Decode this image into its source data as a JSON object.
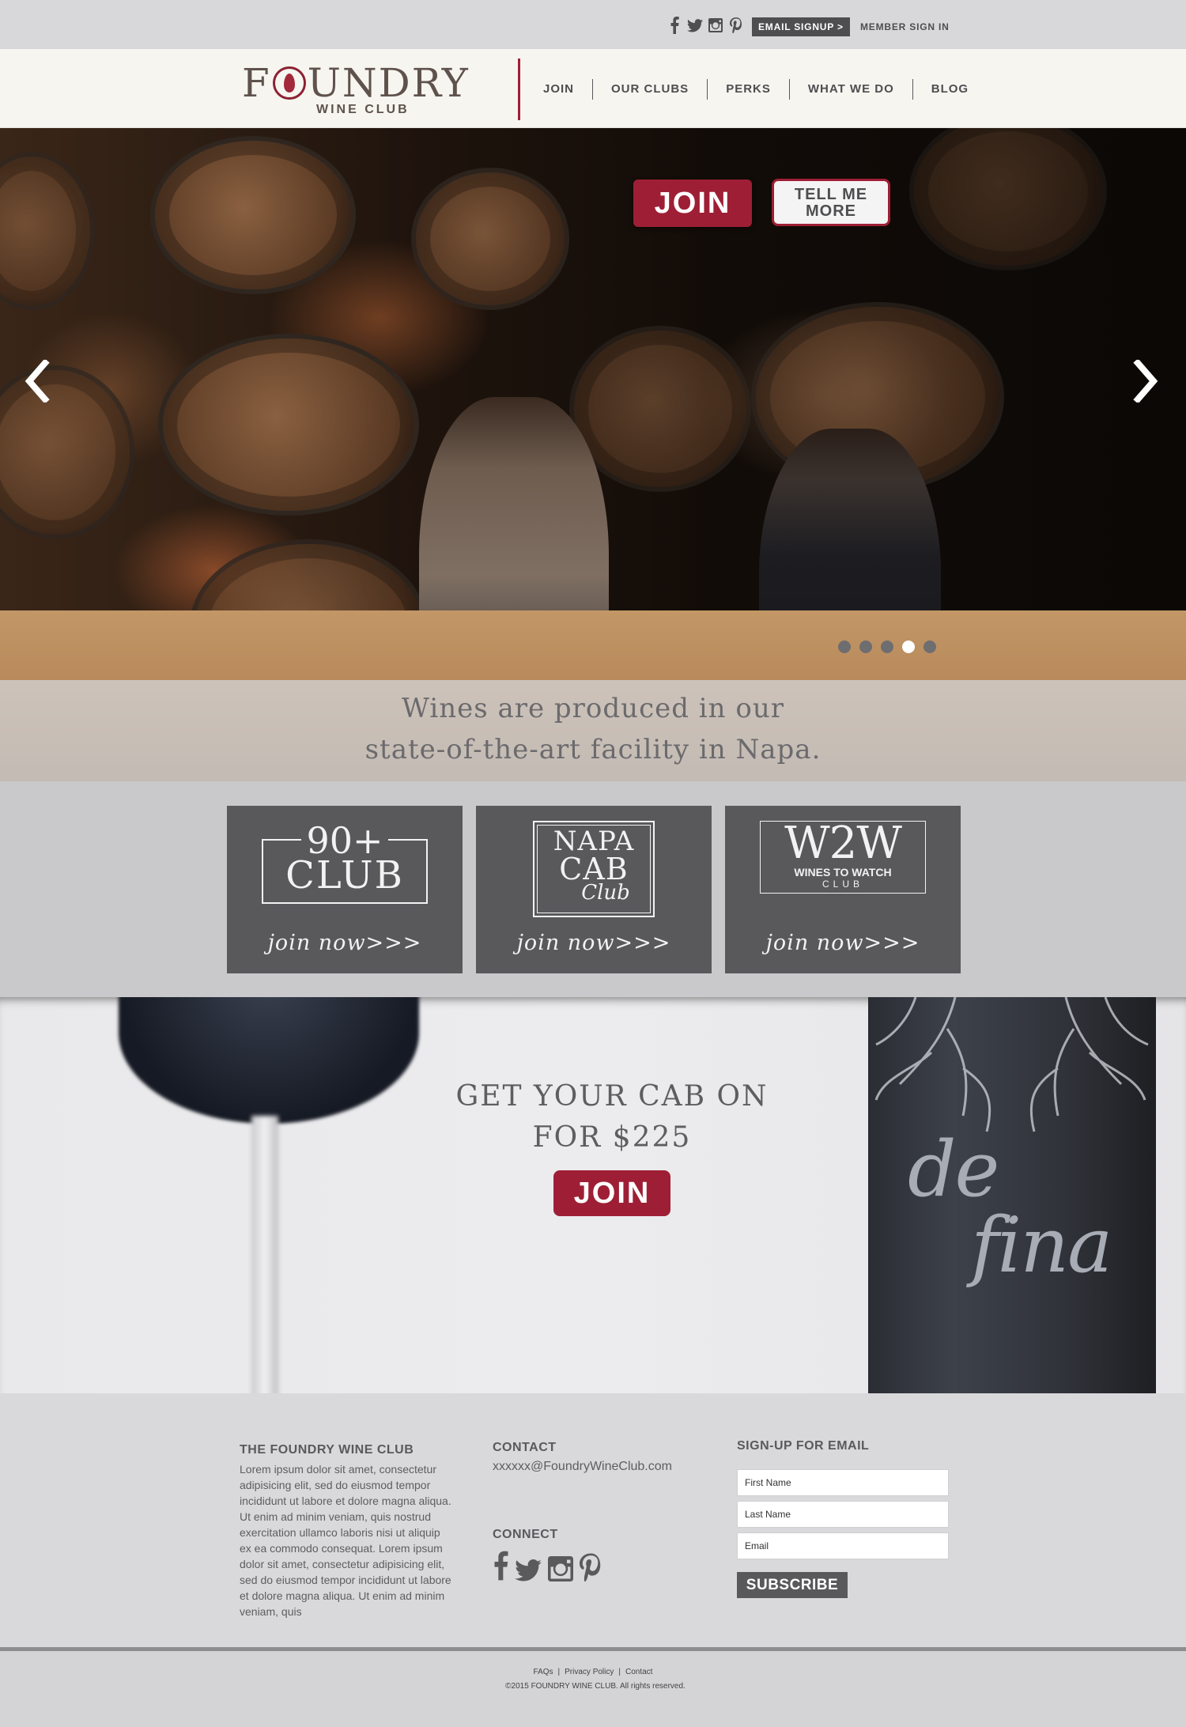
{
  "topbar": {
    "social_icons": [
      "facebook-icon",
      "twitter-icon",
      "instagram-icon",
      "pinterest-icon"
    ],
    "email_signup": "EMAIL SIGNUP >",
    "member_signin": "MEMBER SIGN IN"
  },
  "header": {
    "logo_word": "FOUNDRY",
    "logo_sub": "WINE CLUB",
    "nav": [
      "JOIN",
      "OUR CLUBS",
      "PERKS",
      "WHAT WE DO",
      "BLOG"
    ]
  },
  "hero": {
    "join_label": "JOIN",
    "tell_line1": "TELL ME",
    "tell_line2": "MORE",
    "caption_line1": "Wines are produced in our",
    "caption_line2": "state-of-the-art facility in Napa.",
    "slide_count": 5,
    "active_slide": 4
  },
  "clubs": [
    {
      "logo_line1": "90+",
      "logo_line2": "CLUB",
      "cta": "join now>>>"
    },
    {
      "logo_line1": "NAPA",
      "logo_line2": "CAB",
      "logo_line3": "Club",
      "cta": "join now>>>"
    },
    {
      "logo_line1": "W2W",
      "logo_line2": "WINES TO WATCH",
      "logo_line3": "CLUB",
      "cta": "join now>>>"
    }
  ],
  "promo": {
    "title_line1": "GET YOUR CAB ON",
    "title_line2": "FOR $225",
    "join_label": "JOIN",
    "bottle_text_1": "de",
    "bottle_text_2": "fina"
  },
  "footer": {
    "about_heading": "THE FOUNDRY WINE CLUB",
    "about_text": "Lorem ipsum dolor sit amet, consectetur adipisicing elit, sed do eiusmod tempor incididunt ut labore et dolore magna aliqua. Ut enim ad minim veniam, quis nostrud exercitation ullamco laboris nisi ut aliquip ex ea commodo consequat. Lorem ipsum dolor sit amet, consectetur adipisicing elit, sed do eiusmod tempor incididunt ut labore et dolore magna aliqua. Ut enim ad minim veniam, quis",
    "contact_heading": "CONTACT",
    "contact_email": "xxxxxx@FoundryWineClub.com",
    "connect_heading": "CONNECT",
    "signup_heading": "SIGN-UP FOR EMAIL",
    "first_name_placeholder": "First Name",
    "last_name_placeholder": "Last Name",
    "email_placeholder": "Email",
    "subscribe_label": "SUBSCRIBE"
  },
  "bottom": {
    "links": [
      "FAQs",
      "Privacy Policy",
      "Contact"
    ],
    "copyright": "©2015 FOUNDRY WINE CLUB.  All rights reserved."
  },
  "colors": {
    "brand_red": "#9e1f35",
    "dark_gray": "#59585b",
    "header_bg": "#f6f5f0"
  }
}
